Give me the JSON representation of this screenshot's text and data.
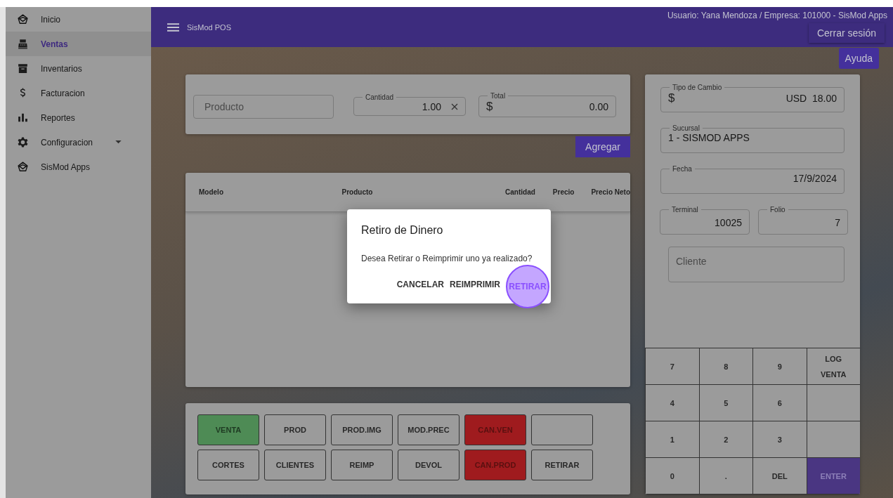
{
  "sidebar": {
    "items": [
      {
        "label": "Inicio",
        "selected": false,
        "expandable": false
      },
      {
        "label": "Ventas",
        "selected": true,
        "expandable": false
      },
      {
        "label": "Inventarios",
        "selected": false,
        "expandable": false
      },
      {
        "label": "Facturacion",
        "selected": false,
        "expandable": false
      },
      {
        "label": "Reportes",
        "selected": false,
        "expandable": false
      },
      {
        "label": "Configuracion",
        "selected": false,
        "expandable": true
      },
      {
        "label": "SisMod Apps",
        "selected": false,
        "expandable": false
      }
    ]
  },
  "header": {
    "title": "SisMod POS",
    "user": "Usuario: Yana Mendoza / Empresa: 101000 - SisMod Apps",
    "logout": "Cerrar sesión"
  },
  "help_button": "Ayuda",
  "entry": {
    "product": {
      "placeholder": "Producto"
    },
    "quantity": {
      "label": "Cantidad",
      "value": "1.00"
    },
    "total": {
      "label": "Total",
      "prefix": "$",
      "value": "0.00"
    },
    "add_button": "Agregar"
  },
  "table": {
    "columns": [
      "Modelo",
      "Producto",
      "Cantidad",
      "Precio",
      "Precio Neto"
    ]
  },
  "actions": [
    {
      "kind": "action",
      "label": "VENTA",
      "color": "#4e8b55"
    },
    {
      "kind": "action",
      "label": "PROD"
    },
    {
      "kind": "action",
      "label": "PROD.IMG"
    },
    {
      "kind": "action",
      "label": "MOD.PREC"
    },
    {
      "kind": "action",
      "label": "CAN.VEN",
      "color": "#9f1b1e"
    },
    {
      "kind": "blank"
    },
    {
      "kind": "action",
      "label": "CORTES"
    },
    {
      "kind": "action",
      "label": "CLIENTES"
    },
    {
      "kind": "action",
      "label": "REIMP"
    },
    {
      "kind": "action",
      "label": "DEVOL"
    },
    {
      "kind": "action",
      "label": "CAN.PROD",
      "color": "#9f1b1e"
    },
    {
      "kind": "action",
      "label": "RETIRAR"
    }
  ],
  "info": {
    "exchange": {
      "label": "Tipo de Cambio",
      "prefix": "$",
      "value": "USD  18.00"
    },
    "branch": {
      "label": "Sucursal",
      "value": "1 - SISMOD APPS"
    },
    "date": {
      "label": "Fecha",
      "value": "17/9/2024"
    },
    "terminal": {
      "label": "Terminal",
      "value": "10025"
    },
    "folio": {
      "label": "Folio",
      "value": "7"
    },
    "client": {
      "placeholder": "Cliente"
    }
  },
  "keypad": [
    {
      "kind": "key",
      "label": "7"
    },
    {
      "kind": "key",
      "label": "8"
    },
    {
      "kind": "key",
      "label": "9"
    },
    {
      "kind": "key",
      "label": "LOG VENTA"
    },
    {
      "kind": "key",
      "label": "4"
    },
    {
      "kind": "key",
      "label": "5"
    },
    {
      "kind": "key",
      "label": "6"
    },
    {
      "kind": "blank"
    },
    {
      "kind": "key",
      "label": "1"
    },
    {
      "kind": "key",
      "label": "2"
    },
    {
      "kind": "key",
      "label": "3"
    },
    {
      "kind": "blank"
    },
    {
      "kind": "key",
      "label": "0"
    },
    {
      "kind": "key",
      "label": "."
    },
    {
      "kind": "key",
      "label": "DEL"
    },
    {
      "kind": "key",
      "label": "ENTER",
      "color": "#4a3682"
    }
  ],
  "dialog": {
    "title": "Retiro de Dinero",
    "message": "Desea Retirar o Reimprimir uno ya realizado?",
    "buttons": [
      {
        "label": "CANCELAR",
        "focused": false
      },
      {
        "label": "REIMPRIMIR",
        "focused": false
      },
      {
        "label": "RETIRAR",
        "focused": true
      }
    ]
  }
}
